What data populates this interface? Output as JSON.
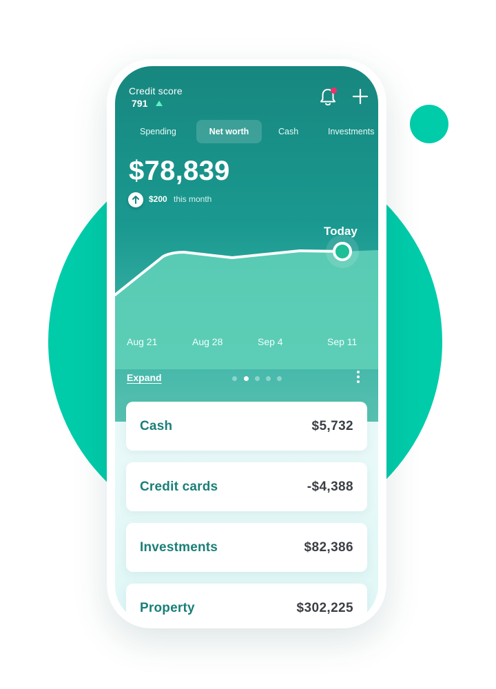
{
  "header": {
    "credit_score_label": "Credit score",
    "credit_score_value": "791",
    "notification_icon": "bell-icon",
    "add_icon": "plus-icon"
  },
  "tabs": [
    {
      "label": "Spending",
      "active": false
    },
    {
      "label": "Net worth",
      "active": true
    },
    {
      "label": "Cash",
      "active": false
    },
    {
      "label": "Investments",
      "active": false
    }
  ],
  "summary": {
    "amount": "$78,839",
    "change_amount": "$200",
    "change_suffix": "this month"
  },
  "chart_data": {
    "type": "area",
    "current_label": "Today",
    "x_labels": [
      "Aug 21",
      "Aug 28",
      "Sep 4",
      "Sep 11"
    ]
  },
  "controls": {
    "expand_label": "Expand",
    "page_count": 5,
    "active_page": 2
  },
  "accounts": [
    {
      "label": "Cash",
      "value": "$5,732"
    },
    {
      "label": "Credit cards",
      "value": "-$4,388"
    },
    {
      "label": "Investments",
      "value": "$82,386"
    },
    {
      "label": "Property",
      "value": "$302,225"
    }
  ],
  "colors": {
    "accent": "#00ccaa",
    "header_teal": "#17877f",
    "label_teal": "#1a7f78",
    "notification_badge": "#f0306a"
  }
}
